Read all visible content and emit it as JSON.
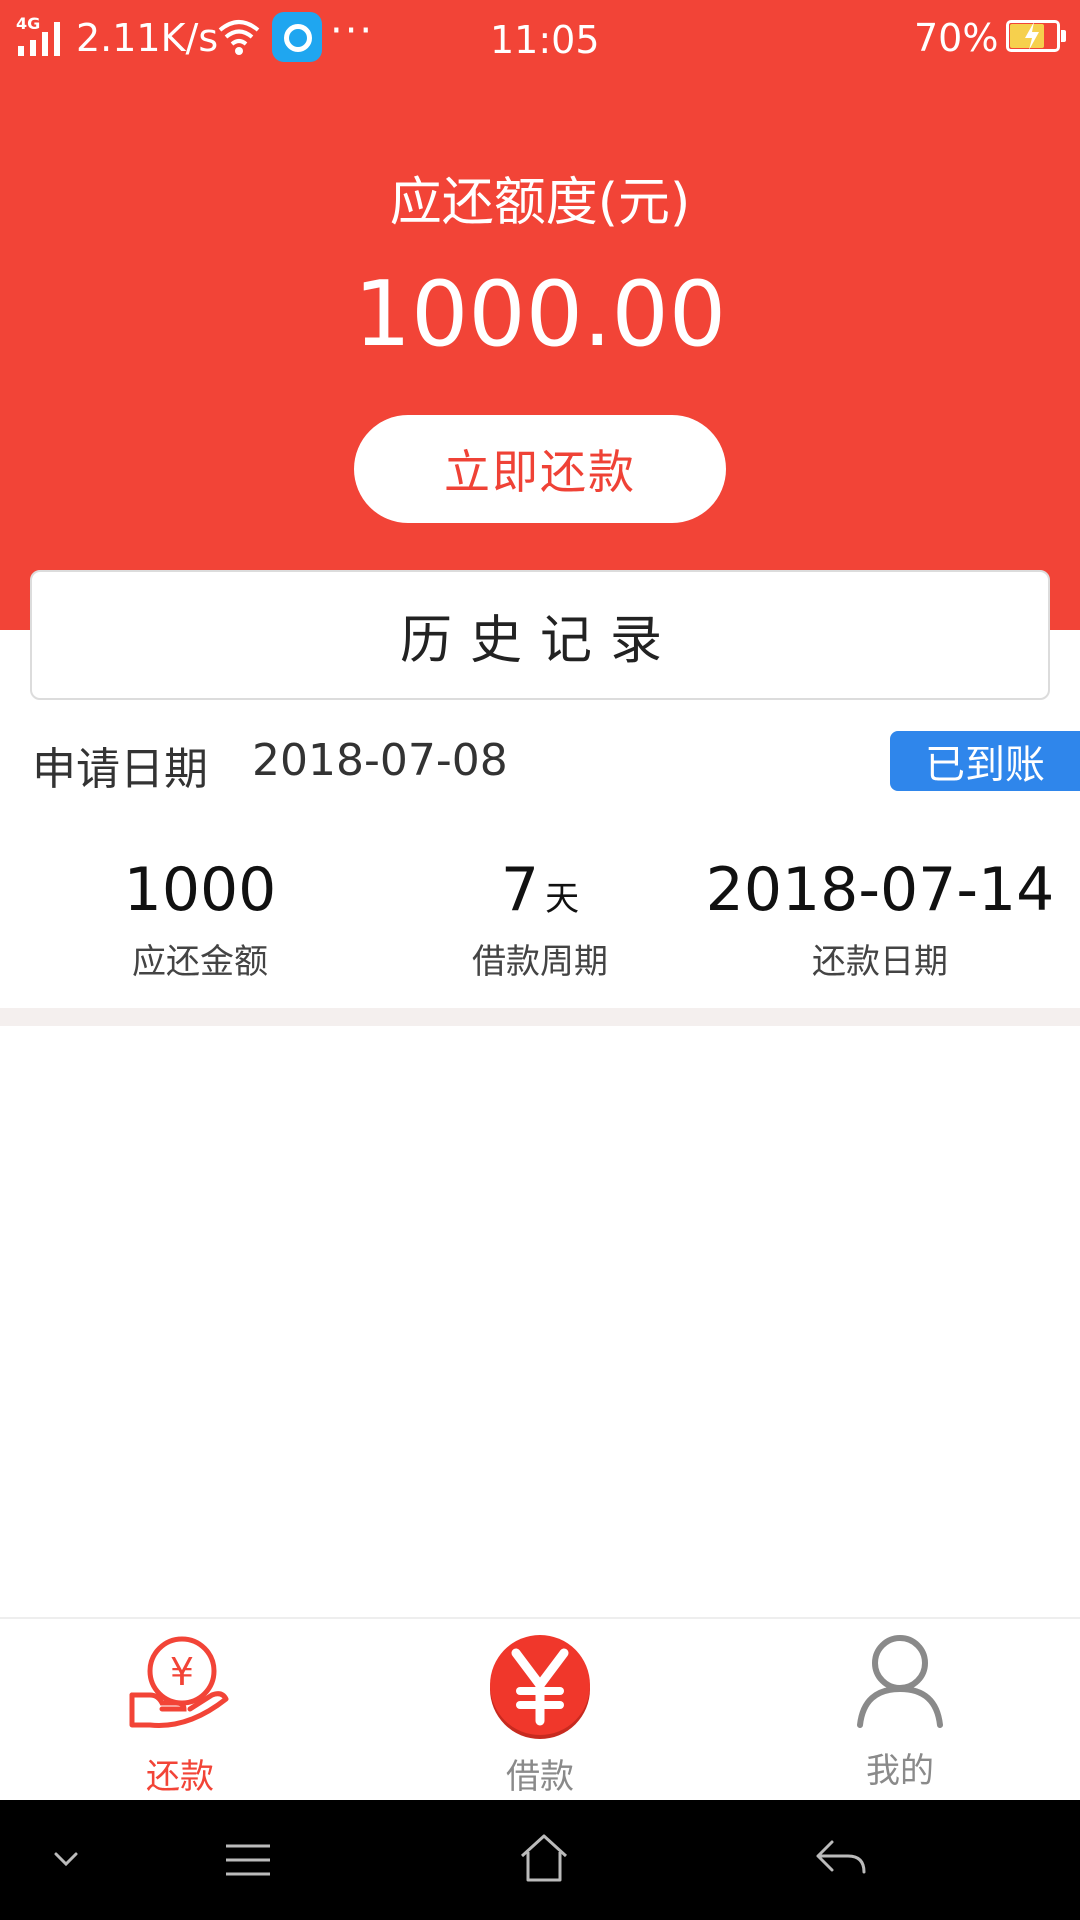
{
  "status_bar": {
    "network": "4G",
    "speed": "2.11K/s",
    "more": "···",
    "time": "11:05",
    "battery": "70%"
  },
  "summary": {
    "title": "应还额度(元)",
    "amount": "1000.00",
    "button": "立即还款"
  },
  "history": {
    "title": "历史记录"
  },
  "record": {
    "date_label": "申请日期",
    "date_value": "2018-07-08",
    "status": "已到账",
    "stats": [
      {
        "value": "1000",
        "unit": "",
        "label": "应还金额"
      },
      {
        "value": "7",
        "unit": "天",
        "label": "借款周期"
      },
      {
        "value": "2018-07-14",
        "unit": "",
        "label": "还款日期"
      }
    ]
  },
  "tabs": [
    {
      "label": "还款",
      "icon": "hand-yuan-icon",
      "active": true
    },
    {
      "label": "借款",
      "icon": "yuan-coin-icon",
      "active": false
    },
    {
      "label": "我的",
      "icon": "user-icon",
      "active": false
    }
  ],
  "colors": {
    "brand_red": "#f24437",
    "badge_blue": "#2f86eb",
    "tab_inactive": "#8a8a8a"
  }
}
